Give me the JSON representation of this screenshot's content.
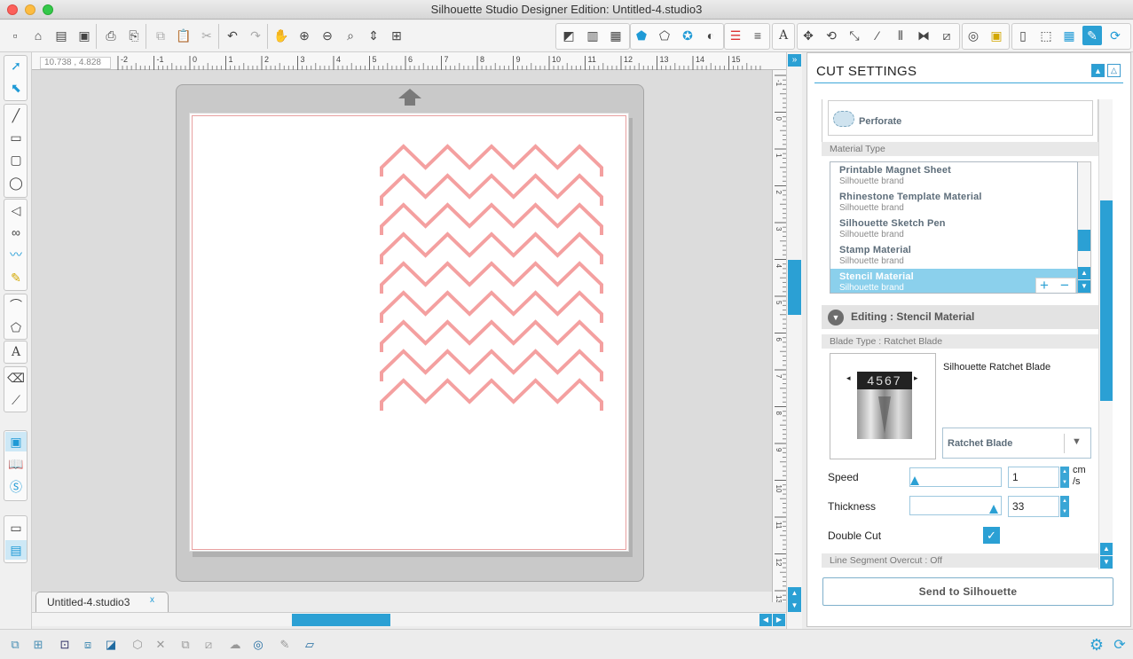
{
  "window": {
    "title": "Silhouette Studio Designer Edition: Untitled-4.studio3"
  },
  "canvas": {
    "coords": "10.738 , 4.828",
    "ruler_top_labels": [
      "-2",
      "-1",
      "0",
      "1",
      "2",
      "3",
      "4",
      "5",
      "6",
      "7",
      "8",
      "9",
      "10",
      "11",
      "12",
      "13",
      "14",
      "15"
    ],
    "ruler_left_labels": [
      "-1",
      "0",
      "1",
      "2",
      "3",
      "4",
      "5",
      "6",
      "7",
      "8",
      "9",
      "10",
      "11",
      "12",
      "13"
    ],
    "doc_tab": "Untitled-4.studio3",
    "doc_tab_close": "x"
  },
  "cut_settings": {
    "title": "CUT SETTINGS",
    "perforate_label": "Perforate",
    "material_type_header": "Material Type",
    "materials": [
      {
        "name": "Printable Magnet Sheet",
        "brand": "Silhouette brand"
      },
      {
        "name": "Rhinestone Template Material",
        "brand": "Silhouette brand"
      },
      {
        "name": "Silhouette Sketch Pen",
        "brand": "Silhouette brand"
      },
      {
        "name": "Stamp Material",
        "brand": "Silhouette brand"
      },
      {
        "name": "Stencil Material",
        "brand": "Silhouette brand",
        "selected": true
      }
    ],
    "add_label": "+",
    "remove_label": "−",
    "editing_label": "Editing : Stencil Material",
    "blade_type_header": "Blade Type : Ratchet Blade",
    "blade_name": "Silhouette Ratchet Blade",
    "blade_dial": "4567",
    "blade_select": "Ratchet Blade",
    "speed_label": "Speed",
    "speed_value": "1",
    "speed_unit": "cm\n/s",
    "speed_fraction": 0.0,
    "thickness_label": "Thickness",
    "thickness_value": "33",
    "thickness_fraction": 0.97,
    "double_cut_label": "Double Cut",
    "double_cut_checked": true,
    "line_segment_header": "Line Segment Overcut : Off",
    "send_button": "Send to Silhouette"
  },
  "colors": {
    "accent": "#2ba0d4",
    "chevron": "#f4a0a0"
  }
}
